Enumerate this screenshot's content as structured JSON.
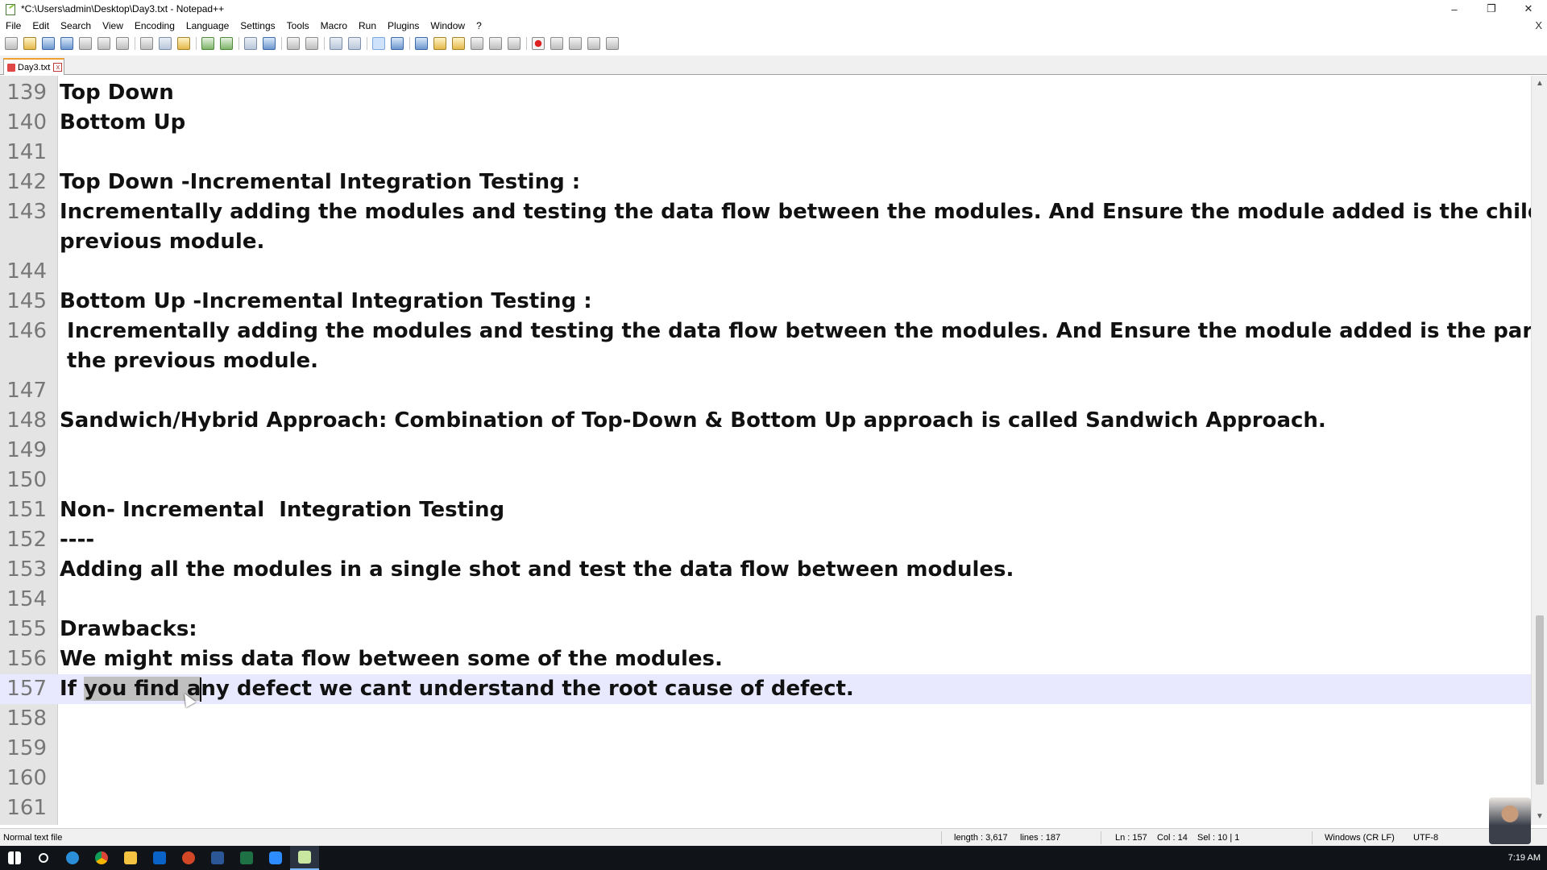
{
  "window": {
    "title": "*C:\\Users\\admin\\Desktop\\Day3.txt - Notepad++",
    "minimize": "–",
    "maximize": "❐",
    "close": "✕"
  },
  "menu": {
    "items": [
      "File",
      "Edit",
      "Search",
      "View",
      "Encoding",
      "Language",
      "Settings",
      "Tools",
      "Macro",
      "Run",
      "Plugins",
      "Window",
      "?"
    ],
    "close_doc": "X"
  },
  "toolbar": {
    "icons": [
      "new-file-icon",
      "open-file-icon",
      "save-icon",
      "save-all-icon",
      "close-icon",
      "close-all-icon",
      "print-icon",
      "cut-icon",
      "copy-icon",
      "paste-icon",
      "undo-icon",
      "redo-icon",
      "find-icon",
      "replace-icon",
      "zoom-in-icon",
      "zoom-out-icon",
      "sync-vertical-icon",
      "sync-horizontal-icon",
      "word-wrap-icon",
      "show-all-chars-icon",
      "indent-guide-icon",
      "user-lang-icon",
      "doc-map-icon",
      "function-list-icon",
      "folder-workspace-icon",
      "monitor-icon",
      "record-macro-icon",
      "stop-macro-icon",
      "play-macro-icon",
      "run-macro-multiple-icon",
      "save-macro-icon"
    ]
  },
  "tab": {
    "label": "Day3.txt",
    "close": "x"
  },
  "editor": {
    "lines": [
      {
        "num": "139",
        "text": "Top Down"
      },
      {
        "num": "140",
        "text": "Bottom Up"
      },
      {
        "num": "141",
        "text": ""
      },
      {
        "num": "142",
        "text": "Top Down -Incremental Integration Testing :"
      },
      {
        "num": "143",
        "text": "Incrementally adding the modules and testing the data flow between the modules. And Ensure the module added is the child of"
      },
      {
        "num": "",
        "text": "previous module."
      },
      {
        "num": "144",
        "text": ""
      },
      {
        "num": "145",
        "text": "Bottom Up -Incremental Integration Testing :"
      },
      {
        "num": "146",
        "text": " Incrementally adding the modules and testing the data flow between the modules. And Ensure the module added is the parent of"
      },
      {
        "num": "",
        "text": " the previous module."
      },
      {
        "num": "147",
        "text": ""
      },
      {
        "num": "148",
        "text": "Sandwich/Hybrid Approach: Combination of Top-Down & Bottom Up approach is called Sandwich Approach."
      },
      {
        "num": "149",
        "text": ""
      },
      {
        "num": "150",
        "text": ""
      },
      {
        "num": "151",
        "text": "Non- Incremental  Integration Testing"
      },
      {
        "num": "152",
        "text": "----"
      },
      {
        "num": "153",
        "text": "Adding all the modules in a single shot and test the data flow between modules."
      },
      {
        "num": "154",
        "text": ""
      },
      {
        "num": "155",
        "text": "Drawbacks:"
      },
      {
        "num": "156",
        "text": "We might miss data flow between some of the modules."
      },
      {
        "num": "157",
        "text": ""
      },
      {
        "num": "158",
        "text": ""
      },
      {
        "num": "159",
        "text": ""
      },
      {
        "num": "160",
        "text": ""
      },
      {
        "num": "161",
        "text": ""
      }
    ],
    "current_line": {
      "before": "If ",
      "selected": "you find a",
      "after": "ny defect we cant understand the root cause of defect."
    }
  },
  "scrollbar": {
    "up": "▲",
    "down": "▼"
  },
  "status": {
    "file_type": "Normal text file",
    "length": "length : 3,617",
    "lines": "lines : 187",
    "ln": "Ln : 157",
    "col": "Col : 14",
    "sel": "Sel : 10 | 1",
    "eol": "Windows (CR LF)",
    "encoding": "UTF-8"
  },
  "taskbar": {
    "apps": [
      "windows-start-icon",
      "search-icon",
      "edge-icon",
      "chrome-icon",
      "file-explorer-icon",
      "outlook-icon",
      "powerpoint-icon",
      "word-icon",
      "excel-icon",
      "zoom-icon",
      "notepad-plus-plus-icon"
    ],
    "clock": "7:19 AM"
  }
}
